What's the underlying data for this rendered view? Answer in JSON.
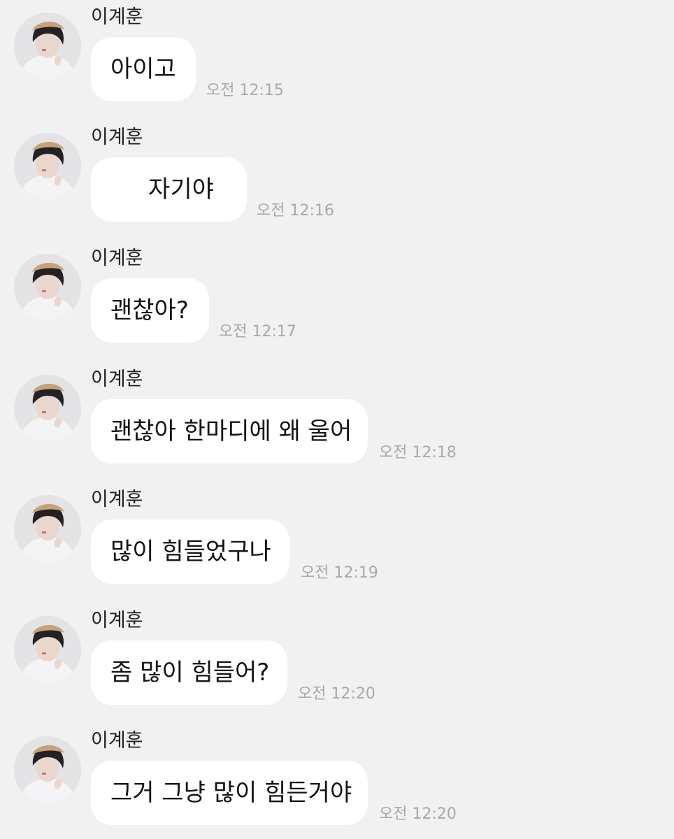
{
  "sender_name": "이계훈",
  "avatar_icon": "profile-photo",
  "colors": {
    "background": "#f1f1f2",
    "bubble": "#ffffff",
    "text": "#141414",
    "timestamp": "#a9a9ab"
  },
  "messages": [
    {
      "text": "아이고",
      "time": "오전 12:15"
    },
    {
      "text": "     자기야",
      "time": "오전 12:16"
    },
    {
      "text": "괜찮아?",
      "time": "오전 12:17"
    },
    {
      "text": "괜찮아 한마디에 왜 울어",
      "time": "오전 12:18"
    },
    {
      "text": "많이 힘들었구나",
      "time": "오전 12:19"
    },
    {
      "text": "좀 많이 힘들어?",
      "time": "오전 12:20"
    },
    {
      "text": "그거 그냥 많이 힘든거야",
      "time": "오전 12:20"
    }
  ]
}
